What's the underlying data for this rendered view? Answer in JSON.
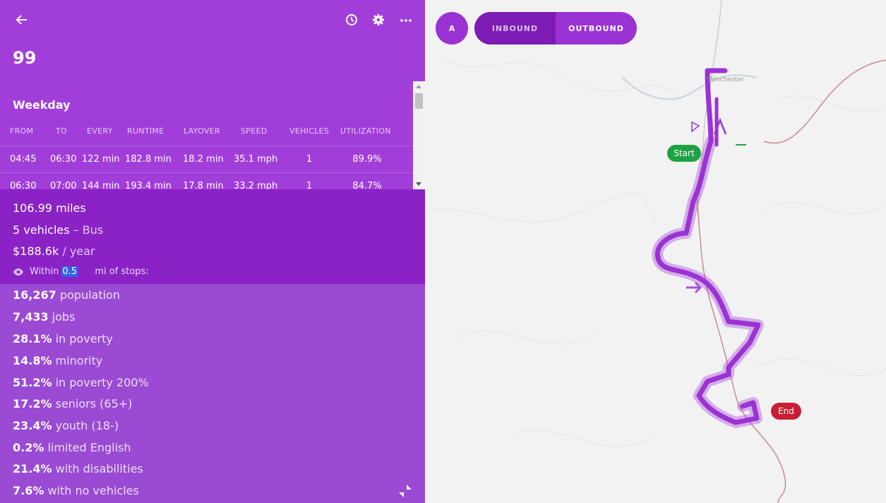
{
  "header": {
    "route_number": "99",
    "icons": [
      "back-arrow-icon",
      "clock-icon",
      "gear-icon",
      "more-icon"
    ]
  },
  "schedule": {
    "label": "Weekday",
    "columns": [
      "FROM",
      "TO",
      "EVERY",
      "RUNTIME",
      "LAYOVER",
      "SPEED",
      "VEHICLES",
      "UTILIZATION"
    ],
    "rows": [
      [
        "04:45",
        "06:30",
        "122 min",
        "182.8 min",
        "18.2 min",
        "35.1 mph",
        "1",
        "89.9%"
      ],
      [
        "06:30",
        "07:00",
        "144 min",
        "193.4 min",
        "17.8 min",
        "33.2 mph",
        "1",
        "84.7%"
      ]
    ]
  },
  "summary": {
    "miles": "106.99 miles",
    "vehicles_count": "5 vehicles",
    "vehicles_mode": " – Bus",
    "cost": "$188.6k",
    "cost_unit": " / year",
    "within_label": "Within",
    "radius_value": "0.5",
    "radius_suffix": "mi of stops:"
  },
  "demographics": [
    {
      "value": "16,267",
      "label": " population"
    },
    {
      "value": "7,433",
      "label": " jobs"
    },
    {
      "value": "28.1%",
      "label": " in poverty"
    },
    {
      "value": "14.8%",
      "label": " minority"
    },
    {
      "value": "51.2%",
      "label": " in poverty 200%"
    },
    {
      "value": "17.2%",
      "label": " seniors (65+)"
    },
    {
      "value": "23.4%",
      "label": " youth (18-)"
    },
    {
      "value": "0.2%",
      "label": " limited English"
    },
    {
      "value": "21.4%",
      "label": " with disabilities"
    },
    {
      "value": "7.6%",
      "label": " with no vehicles"
    }
  ],
  "map": {
    "direction_a": "A",
    "inbound_label": "INBOUND",
    "outbound_label": "OUTBOUND",
    "selected_direction": "OUTBOUND",
    "start_label": "Start",
    "end_label": "End",
    "town_label": "Winchester",
    "route_color": "#9b32d4",
    "start_color": "#1ea244",
    "end_color": "#c81e37"
  }
}
